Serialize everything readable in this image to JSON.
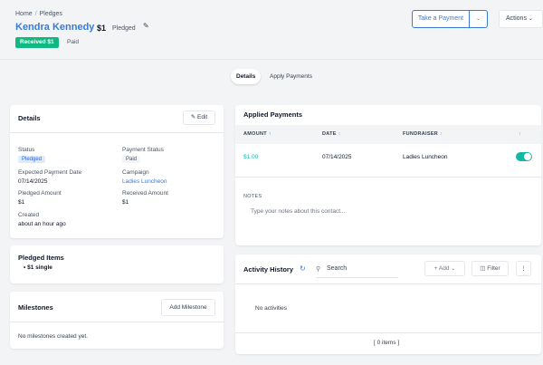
{
  "breadcrumb": {
    "home": "Home",
    "separator": "/",
    "current": "Pledges"
  },
  "header": {
    "name": "Kendra Kennedy",
    "amount": "$1",
    "status": "Pledged",
    "received_badge": "Received $1",
    "payment_status": "Paid",
    "take_payment_label": "Take a Payment",
    "actions_label": "Actions"
  },
  "tabs": [
    "Details",
    "Apply Payments"
  ],
  "details": {
    "title": "Details",
    "edit_label": "Edit",
    "status_label": "Status",
    "status_value": "Pledged",
    "payment_status_label": "Payment Status",
    "payment_status_value": "Paid",
    "expected_date_label": "Expected Payment Date",
    "expected_date_value": "07/14/2025",
    "campaign_label": "Campaign",
    "campaign_value": "Ladies Luncheon",
    "pledged_amount_label": "Pledged Amount",
    "pledged_amount_value": "$1",
    "received_amount_label": "Received Amount",
    "received_amount_value": "$1",
    "created_label": "Created",
    "created_value": "about an hour ago"
  },
  "pledged_items": {
    "title": "Pledged Items",
    "items": [
      "$1 single"
    ]
  },
  "milestones": {
    "title": "Milestones",
    "add_label": "Add Milestone",
    "empty": "No milestones created yet."
  },
  "applied_payments": {
    "title": "Applied Payments",
    "columns": [
      "AMOUNT",
      "DATE",
      "FUNDRAISER"
    ],
    "rows": [
      {
        "amount": "$1.00",
        "date": "07/14/2025",
        "fundraiser": "Ladies Luncheon",
        "enabled": true
      }
    ]
  },
  "notes": {
    "label": "NOTES",
    "placeholder": "Type your notes about this contact..."
  },
  "activity": {
    "title": "Activity History",
    "search_placeholder": "Search",
    "add_label": "Add",
    "filter_label": "Filter",
    "empty": "No activities",
    "count": "[ 0 items ]"
  },
  "colors": {
    "accent": "#3a7bd5",
    "success": "#10b981",
    "toggle": "#14b8a6"
  }
}
